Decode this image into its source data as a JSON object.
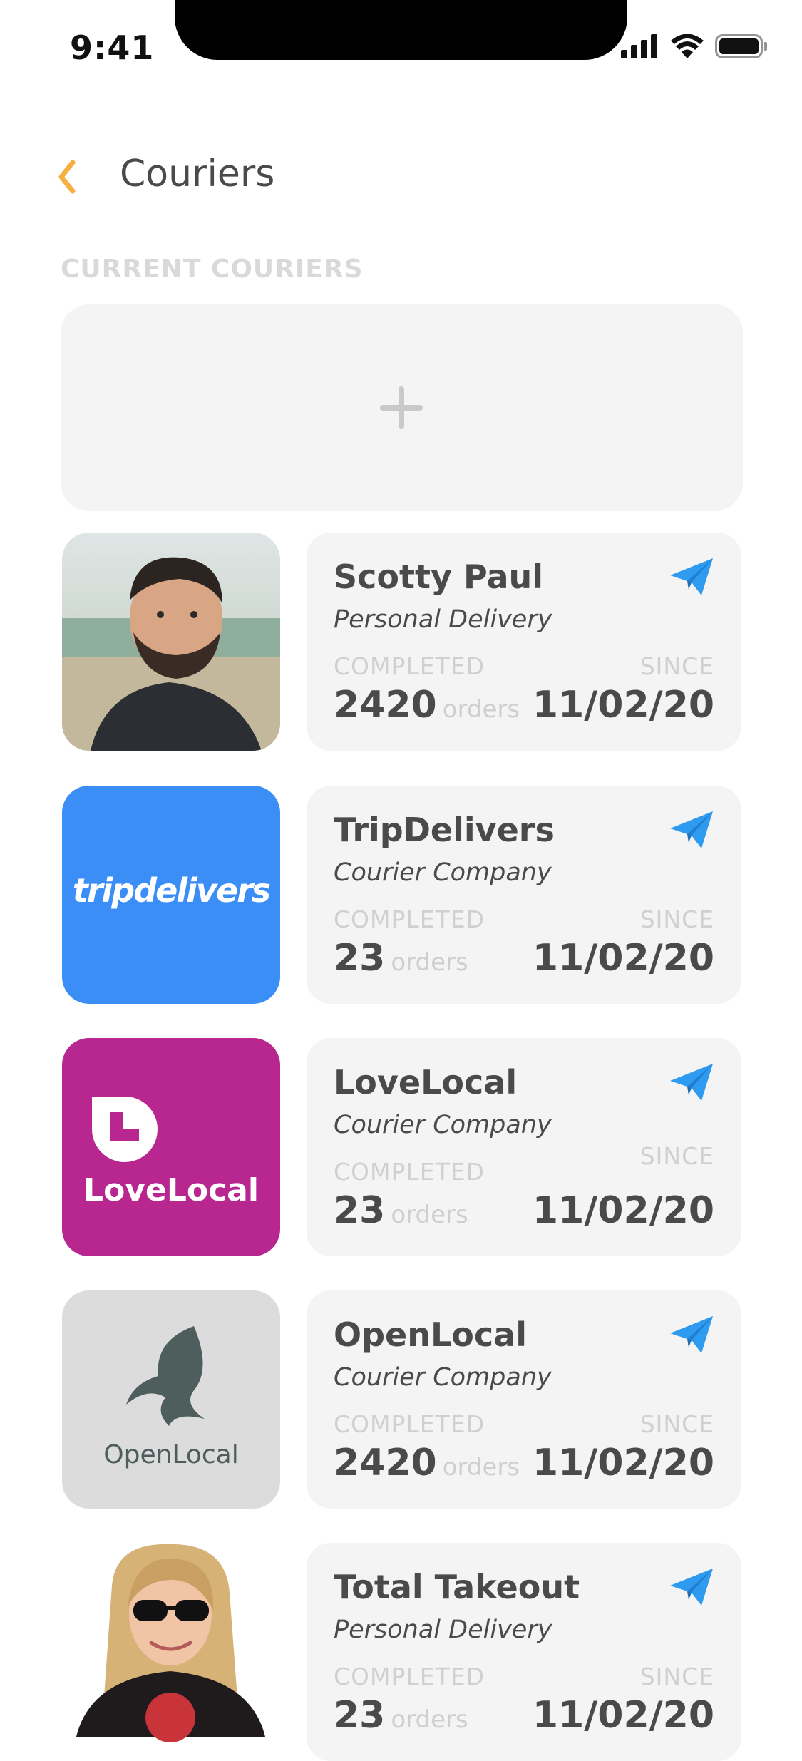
{
  "status_bar": {
    "time": "9:41"
  },
  "header": {
    "title": "Couriers"
  },
  "section": {
    "label": "CURRENT COURIERS"
  },
  "couriers": [
    {
      "name": "Scotty Paul",
      "type": "Personal Delivery",
      "completed_label": "COMPLETED",
      "count": "2420",
      "orders_label": "orders",
      "since_label": "SINCE",
      "since": "11/02/20",
      "avatar": "person-photo",
      "avatar_text": ""
    },
    {
      "name": "TripDelivers",
      "type": "Courier Company",
      "completed_label": "COMPLETED",
      "count": "23",
      "orders_label": "orders",
      "since_label": "SINCE",
      "since": "11/02/20",
      "avatar": "tripdelivers-logo",
      "avatar_text": "tripdelivers"
    },
    {
      "name": "LoveLocal",
      "type": "Courier Company",
      "completed_label": "COMPLETED",
      "count": "23",
      "orders_label": "orders",
      "since_label": "SINCE",
      "since": "11/02/20",
      "avatar": "lovelocal-logo",
      "avatar_text": "LoveLocal"
    },
    {
      "name": "OpenLocal",
      "type": "Courier Company",
      "completed_label": "COMPLETED",
      "count": "2420",
      "orders_label": "orders",
      "since_label": "SINCE",
      "since": "11/02/20",
      "avatar": "openlocal-logo",
      "avatar_text": "OpenLocal"
    },
    {
      "name": "Total Takeout",
      "type": "Personal Delivery",
      "completed_label": "COMPLETED",
      "count": "23",
      "orders_label": "orders",
      "since_label": "SINCE",
      "since": "11/02/20",
      "avatar": "person-photo",
      "avatar_text": ""
    }
  ],
  "colors": {
    "accent": "#f5b041",
    "send": "#2f9bf0",
    "tripdelivers_bg": "#3b8ef5",
    "lovelocal_bg": "#b8268f",
    "openlocal_bg": "#dcdcdc",
    "card_bg": "#f4f4f4"
  },
  "icons": {
    "back": "chevron-left-icon",
    "add": "plus-icon",
    "send": "paper-plane-icon"
  }
}
